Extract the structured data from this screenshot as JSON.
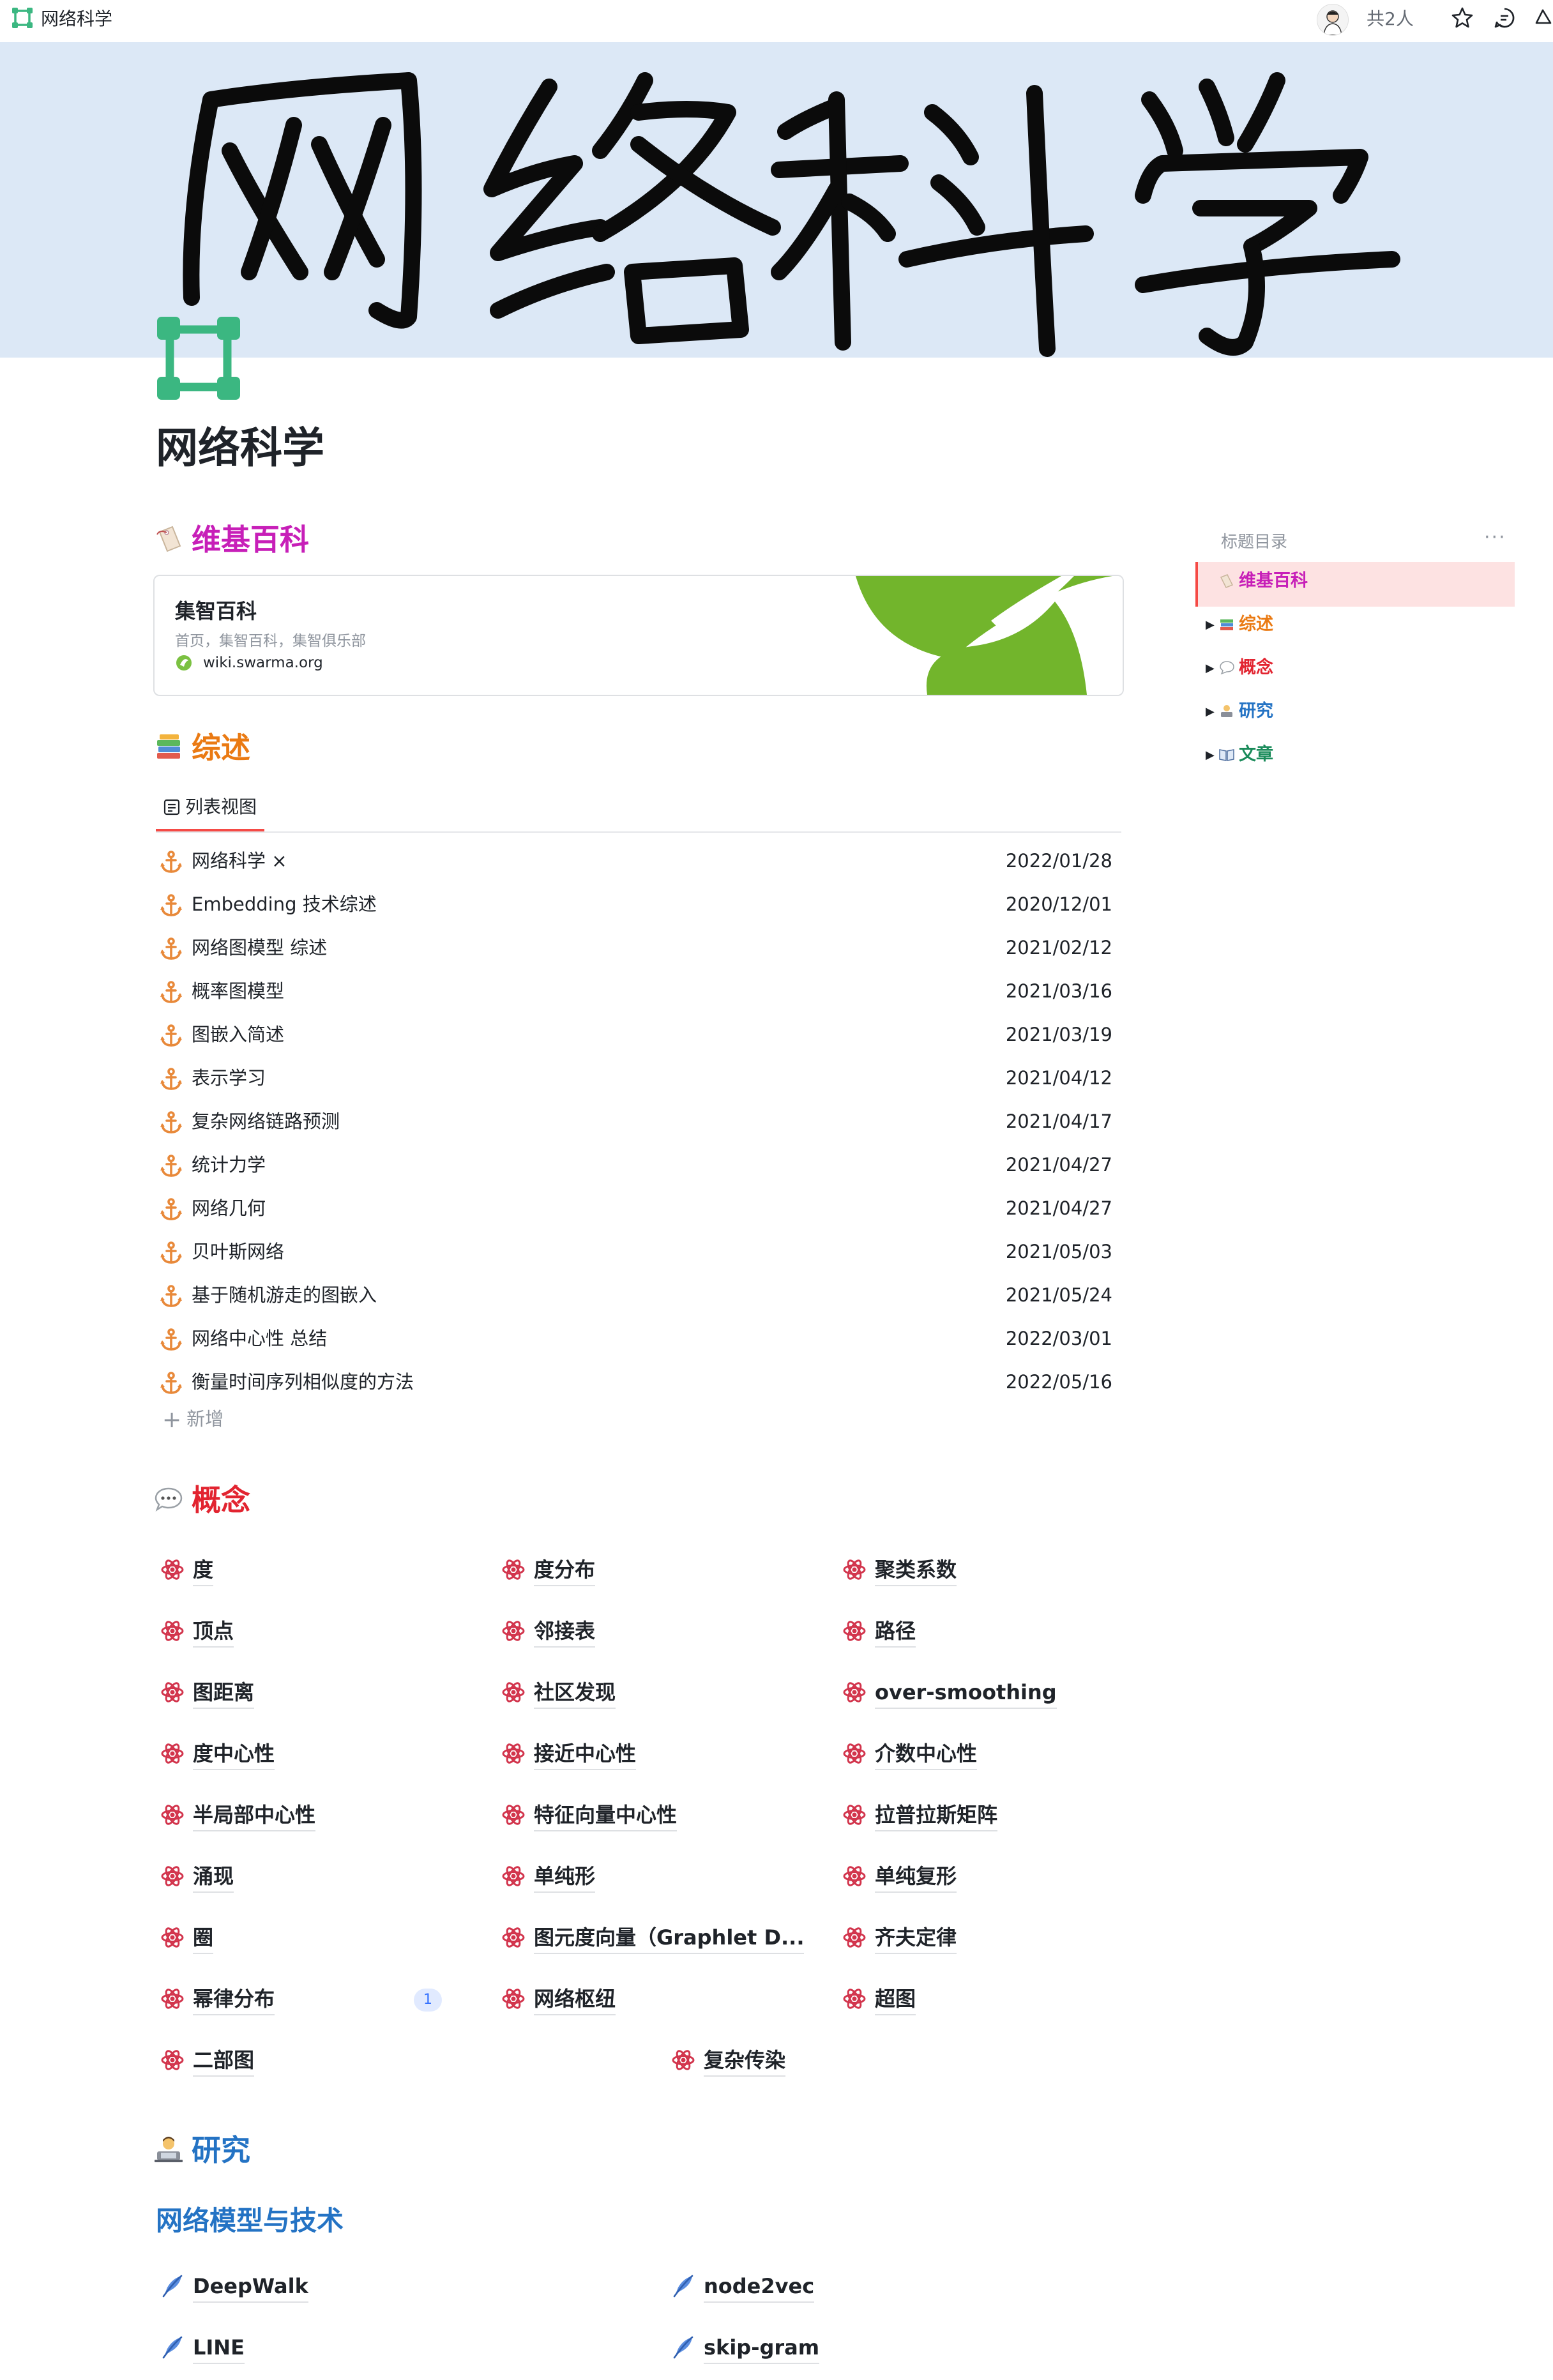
{
  "topbar": {
    "title": "网络科学",
    "collaborators": "共2人"
  },
  "cover": {
    "handwritten_text": "网络科学"
  },
  "page": {
    "title": "网络科学"
  },
  "wiki": {
    "heading": "维基百科",
    "card": {
      "title": "集智百科",
      "description": "首页，集智百科，集智俱乐部",
      "url": "wiki.swarma.org"
    }
  },
  "overview": {
    "heading": "综述",
    "view_tab": "列表视图",
    "add_label": "新增",
    "rows": [
      {
        "name": "网络科学 ×",
        "date": "2022/01/28"
      },
      {
        "name": "Embedding 技术综述",
        "date": "2020/12/01"
      },
      {
        "name": "网络图模型 综述",
        "date": "2021/02/12"
      },
      {
        "name": "概率图模型",
        "date": "2021/03/16"
      },
      {
        "name": "图嵌入简述",
        "date": "2021/03/19"
      },
      {
        "name": "表示学习",
        "date": "2021/04/12"
      },
      {
        "name": "复杂网络链路预测",
        "date": "2021/04/17"
      },
      {
        "name": "统计力学",
        "date": "2021/04/27"
      },
      {
        "name": "网络几何",
        "date": "2021/04/27"
      },
      {
        "name": "贝叶斯网络",
        "date": "2021/05/03"
      },
      {
        "name": "基于随机游走的图嵌入",
        "date": "2021/05/24"
      },
      {
        "name": "网络中心性 总结",
        "date": "2022/03/01"
      },
      {
        "name": "衡量时间序列相似度的方法",
        "date": "2022/05/16"
      }
    ]
  },
  "concepts": {
    "heading": "概念",
    "items": [
      "度",
      "度分布",
      "聚类系数",
      "顶点",
      "邻接表",
      "路径",
      "图距离",
      "社区发现",
      "over-smoothing",
      "度中心性",
      "接近中心性",
      "介数中心性",
      "半局部中心性",
      "特征向量中心性",
      "拉普拉斯矩阵",
      "涌现",
      "单纯形",
      "单纯复形",
      "圈",
      "图元度向量（Graphlet D...",
      "齐夫定律",
      "幂律分布",
      "网络枢纽",
      "超图",
      "二部图",
      "复杂传染"
    ],
    "comment_count": "1"
  },
  "research": {
    "heading": "研究",
    "subheading": "网络模型与技术",
    "items": [
      "DeepWalk",
      "node2vec",
      "LINE",
      "skip-gram"
    ]
  },
  "outline": {
    "title": "标题目录",
    "items": [
      {
        "label": "维基百科",
        "color": "#c71fb8"
      },
      {
        "label": "综述",
        "color": "#ea7a13"
      },
      {
        "label": "概念",
        "color": "#e22430"
      },
      {
        "label": "研究",
        "color": "#2473c4"
      },
      {
        "label": "文章",
        "color": "#1a8b5a"
      }
    ]
  },
  "colors": {
    "wiki": "#c71fb8",
    "overview": "#ea7a13",
    "concepts": "#e22430",
    "research": "#2473c4",
    "articles": "#1a8b5a",
    "accent": "#f54a45",
    "cover_bg": "#dce8f6",
    "page_icon": "#3bb781"
  },
  "icons": {
    "list_row": "anchor-icon",
    "concept": "atom-icon",
    "research": "feather-icon"
  }
}
